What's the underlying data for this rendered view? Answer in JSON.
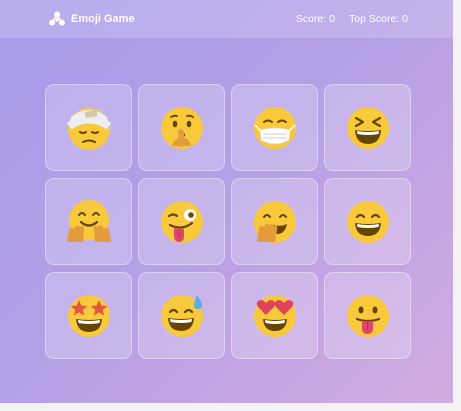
{
  "app": {
    "brand": "Emoji Game",
    "score_label": "Score:",
    "score": 0,
    "top_score_label": "Top Score:",
    "top_score": 0
  },
  "colors": {
    "background_start": "#a79bea",
    "background_end": "#d2ace0",
    "emoji_face": "#f9c93c",
    "emoji_feature": "#664500"
  },
  "cards": [
    {
      "name": "face-with-head-bandage"
    },
    {
      "name": "shushing-face"
    },
    {
      "name": "face-with-medical-mask"
    },
    {
      "name": "grinning-squinting-face"
    },
    {
      "name": "hugging-face"
    },
    {
      "name": "winking-face-with-tongue"
    },
    {
      "name": "face-with-hand-over-mouth"
    },
    {
      "name": "grinning-face-with-smiling-eyes"
    },
    {
      "name": "star-struck"
    },
    {
      "name": "grinning-face-with-sweat"
    },
    {
      "name": "smiling-face-with-heart-eyes"
    },
    {
      "name": "face-with-tongue"
    }
  ]
}
